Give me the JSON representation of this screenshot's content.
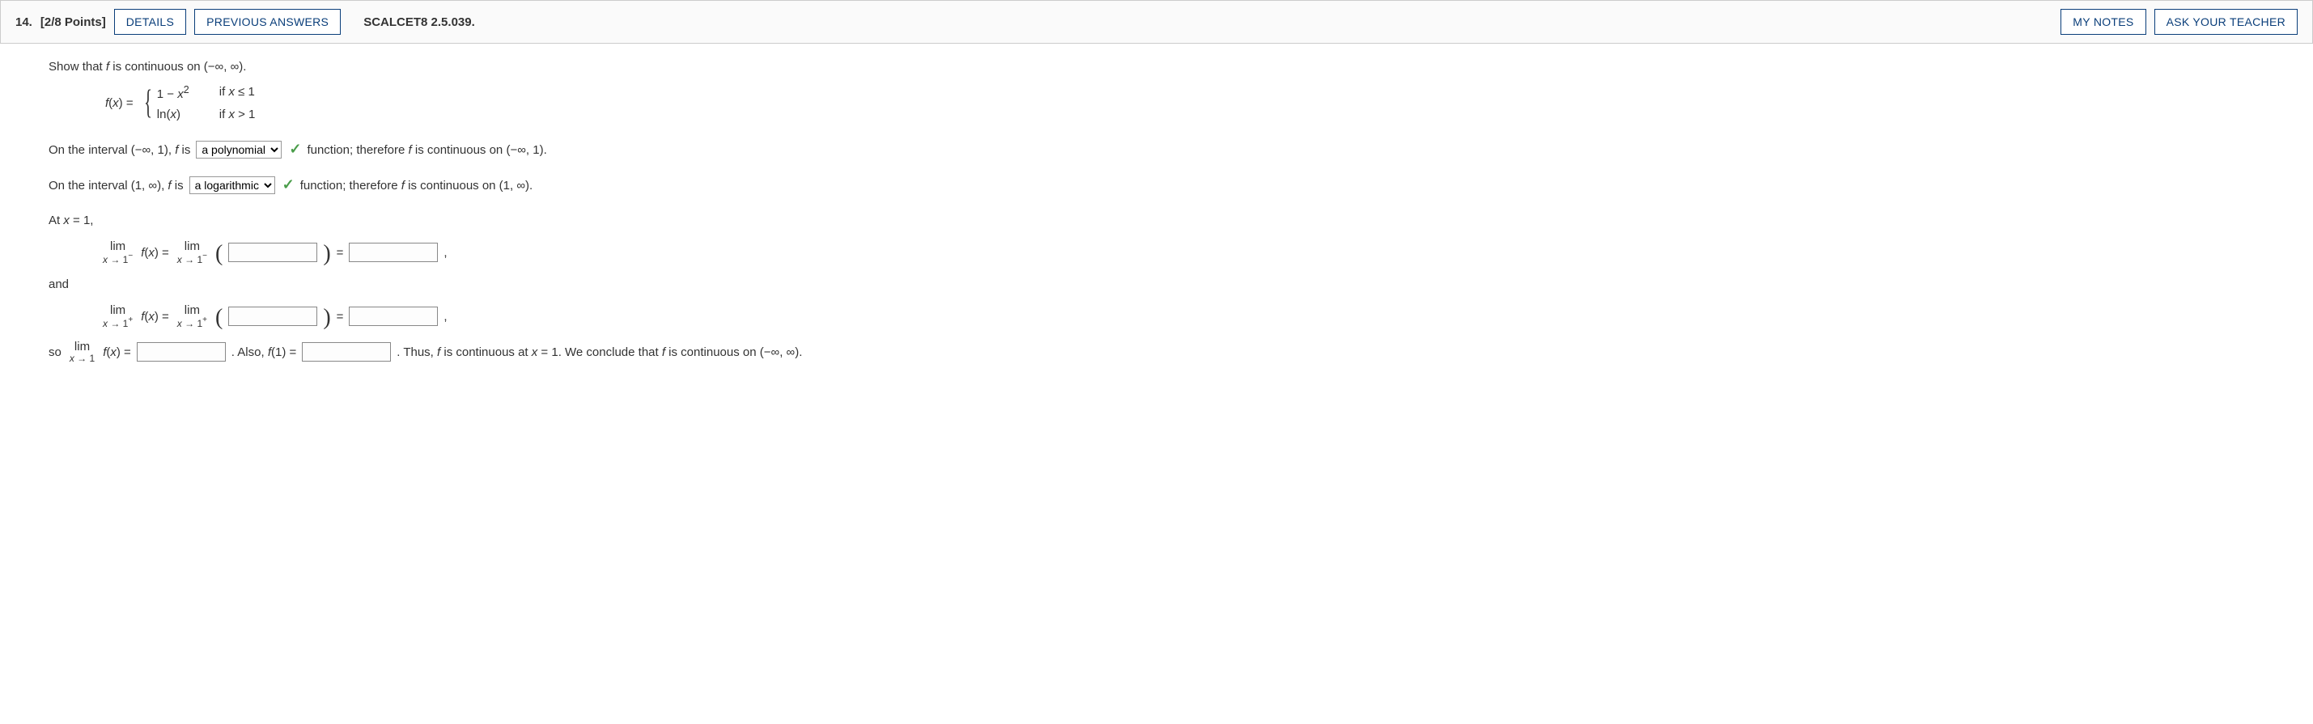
{
  "header": {
    "number": "14.",
    "points": "[2/8 Points]",
    "details": "DETAILS",
    "previous": "PREVIOUS ANSWERS",
    "source": "SCALCET8 2.5.039.",
    "mynotes": "MY NOTES",
    "ask": "ASK YOUR TEACHER"
  },
  "prompt": {
    "t1": "Show that ",
    "f": "f",
    "t2": " is continuous on (−∞, ∞)."
  },
  "fxdef": {
    "lhs1": "f",
    "lhs2": "(",
    "lhs3": "x",
    "lhs4": ") = ",
    "p1a": "1 − ",
    "p1b": "x",
    "p1c": "2",
    "p1cond_a": "if ",
    "p1cond_b": "x",
    "p1cond_c": " ≤ 1",
    "p2a": "ln(",
    "p2b": "x",
    "p2c": ")",
    "p2cond_a": "if ",
    "p2cond_b": "x",
    "p2cond_c": " > 1"
  },
  "line1": {
    "t1": "On the interval  (−∞, 1),  ",
    "f": "f",
    "t2": " is",
    "sel": "a polynomial",
    "t3": "function; therefore ",
    "t4": " is continuous on  (−∞, 1)."
  },
  "line2": {
    "t1": "On the interval  (1, ∞),  ",
    "f": "f",
    "t2": " is",
    "sel": "a logarithmic",
    "t3": "function; therefore ",
    "t4": " is continuous on  (1, ∞)."
  },
  "atline": {
    "t1": "At  ",
    "x": "x",
    "t2": " = 1,"
  },
  "limrow": {
    "lim": "lim",
    "sub_minus_a": "x",
    "sub_minus_b": " → 1",
    "minus": "−",
    "plus": "+",
    "sub1_a": "x",
    "sub1_b": " → 1",
    "fx_f": "f",
    "fx_open": "(",
    "fx_x": "x",
    "fx_close": ")",
    "eq": " = ",
    "eq2": "=",
    "comma": ","
  },
  "and": "and",
  "soRow": {
    "so": "so  ",
    "also_a": ".  Also,  ",
    "also_f": "f",
    "also_b": "(1) = ",
    "thus_a": ".  Thus, ",
    "thus_f": "f",
    "thus_b": " is continuous at  ",
    "thus_x": "x",
    "thus_c": " = 1.  We conclude that ",
    "thus_f2": "f",
    "thus_d": " is continuous on  (−∞, ∞)."
  },
  "selectOptions": {
    "opt1": "a polynomial",
    "opt2": "a logarithmic"
  }
}
